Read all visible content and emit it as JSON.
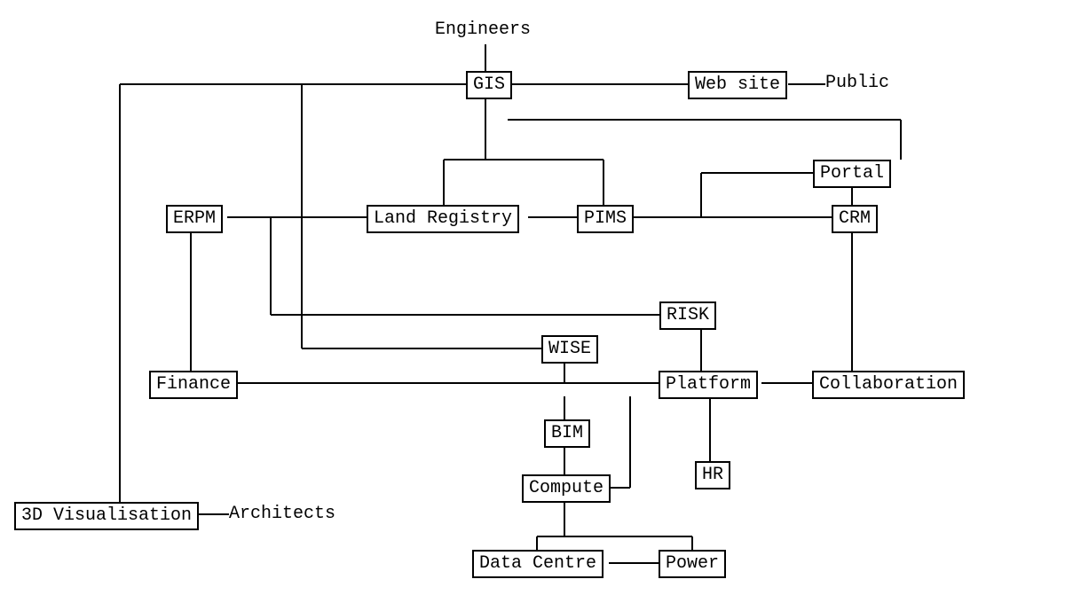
{
  "nodes": {
    "engineers": {
      "label": "Engineers"
    },
    "gis": {
      "label": "GIS"
    },
    "website": {
      "label": "Web site"
    },
    "public": {
      "label": "Public"
    },
    "portal": {
      "label": "Portal"
    },
    "erpm": {
      "label": "ERPM"
    },
    "land": {
      "label": "Land Registry"
    },
    "pims": {
      "label": "PIMS"
    },
    "crm": {
      "label": "CRM"
    },
    "risk": {
      "label": "RISK"
    },
    "wise": {
      "label": "WISE"
    },
    "finance": {
      "label": "Finance"
    },
    "platform": {
      "label": "Platform"
    },
    "collab": {
      "label": "Collaboration"
    },
    "bim": {
      "label": "BIM"
    },
    "hr": {
      "label": "HR"
    },
    "compute": {
      "label": "Compute"
    },
    "viz3d": {
      "label": "3D Visualisation"
    },
    "architects": {
      "label": "Architects"
    },
    "datacentre": {
      "label": "Data Centre"
    },
    "power": {
      "label": "Power"
    }
  }
}
